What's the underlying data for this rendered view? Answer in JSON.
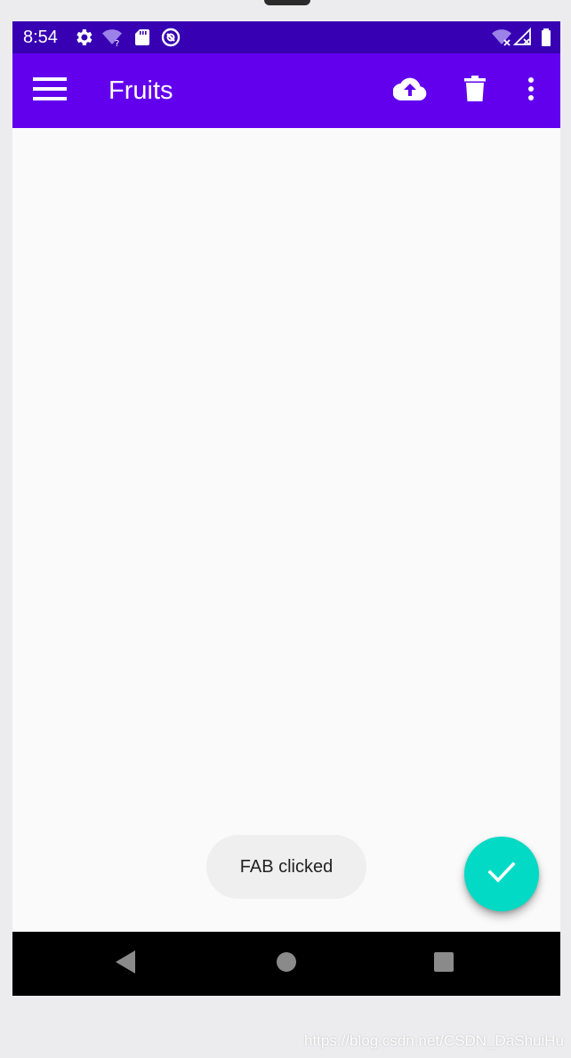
{
  "status_bar": {
    "time": "8:54",
    "background_color": "#3700b3",
    "left_icons": [
      "gear-icon",
      "wifi-unknown-icon",
      "sd-card-icon",
      "data-saver-icon"
    ],
    "right_icons": [
      "wifi-off-icon",
      "signal-off-icon",
      "battery-full-icon"
    ]
  },
  "app_bar": {
    "title": "Fruits",
    "background_color": "#6200ee",
    "nav_icon": "hamburger-menu-icon",
    "actions": [
      "cloud-upload-icon",
      "delete-icon",
      "more-vert-icon"
    ]
  },
  "toast": {
    "text": "FAB clicked"
  },
  "fab": {
    "icon": "check-icon",
    "color": "#03dac5"
  },
  "nav_bar": {
    "buttons": [
      "back-icon",
      "home-icon",
      "recents-icon"
    ]
  },
  "watermark": {
    "text": "https://blog.csdn.net/CSDN_DaShuiHu"
  }
}
